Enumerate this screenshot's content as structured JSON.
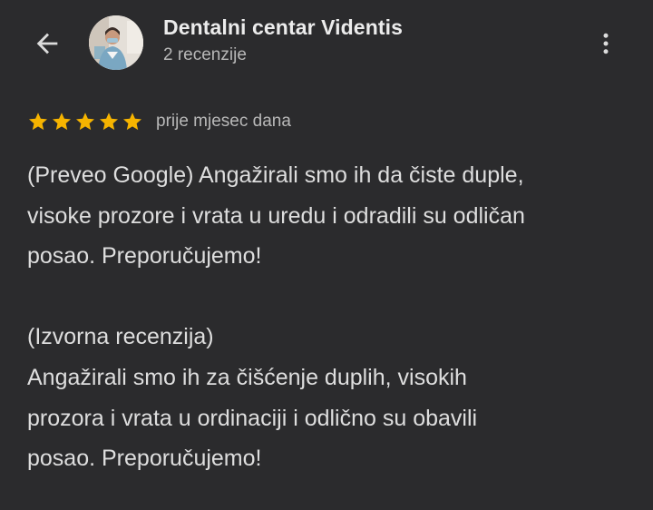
{
  "header": {
    "back_icon": "arrow-back-icon",
    "avatar_icon": "business-avatar-photo",
    "title": "Dentalni centar Videntis",
    "subtitle": "2 recenzije",
    "more_icon": "more-vert-icon"
  },
  "review": {
    "rating": 5,
    "rating_max": 5,
    "star_color": "#f6b400",
    "date": "prije mjesec dana",
    "translated_text": "(Preveo Google) Angažirali smo ih da čiste duple,\nvisoke prozore i vrata u uredu i odradili su odličan\nposao. Preporučujemo!",
    "original_text": "(Izvorna recenzija)\nAngažirali smo ih za čišćenje duplih, visokih\nprozora i vrata u ordinaciji i odlično su obavili\nposao. Preporučujemo!"
  },
  "colors": {
    "background": "#2b2b2d",
    "text_primary": "#e3e3e3",
    "text_secondary": "#b8b8b8"
  }
}
